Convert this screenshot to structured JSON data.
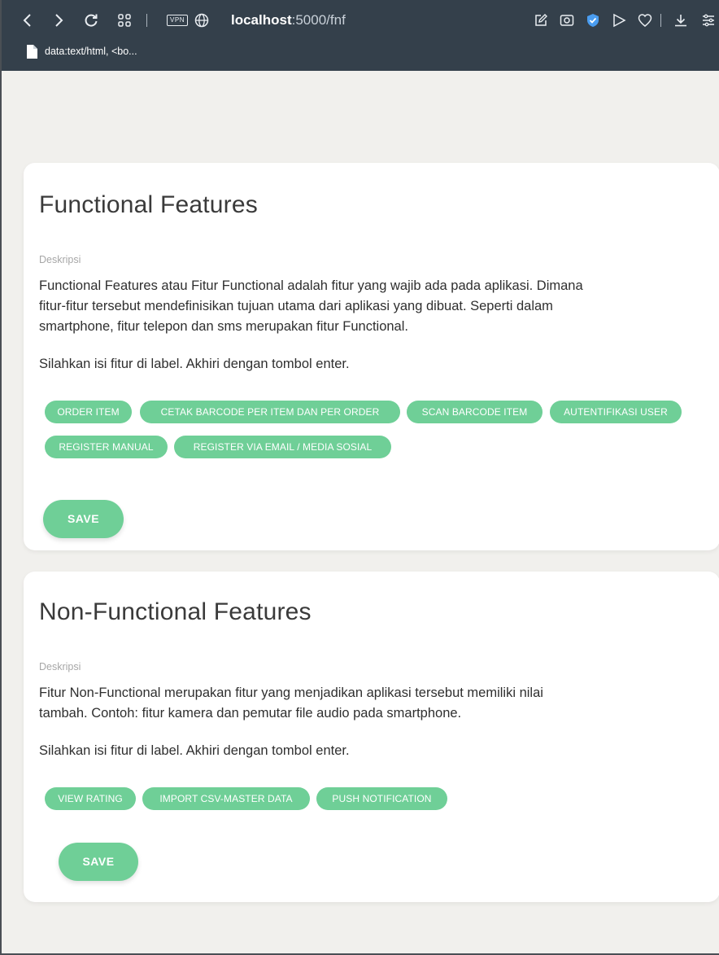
{
  "browser": {
    "vpn_label": "VPN",
    "url_host": "localhost",
    "url_path": ":5000/fnf",
    "tab_title": "data:text/html, <bo..."
  },
  "cards": [
    {
      "title": "Functional Features",
      "desc_label": "Deskripsi",
      "desc_lines": [
        "Functional Features atau Fitur Functional adalah fitur yang wajib ada pada aplikasi. Dimana",
        "fitur-fitur tersebut mendefinisikan tujuan utama dari aplikasi yang dibuat. Seperti dalam",
        "smartphone, fitur telepon dan sms merupakan fitur Functional."
      ],
      "hint": "Silahkan isi fitur di label. Akhiri dengan tombol enter.",
      "tags": [
        "ORDER ITEM",
        "CETAK BARCODE PER ITEM DAN PER ORDER",
        "SCAN BARCODE ITEM",
        "AUTENTIFIKASI USER",
        "REGISTER MANUAL",
        "REGISTER VIA EMAIL / MEDIA SOSIAL"
      ],
      "save_label": "SAVE"
    },
    {
      "title": "Non-Functional Features",
      "desc_label": "Deskripsi",
      "desc_lines": [
        "Fitur Non-Functional merupakan fitur yang menjadikan aplikasi tersebut memiliki nilai",
        "tambah. Contoh: fitur kamera dan pemutar file audio pada smartphone."
      ],
      "hint": "Silahkan isi fitur di label. Akhiri dengan tombol enter.",
      "tags": [
        "VIEW RATING",
        "IMPORT CSV-MASTER DATA",
        "PUSH NOTIFICATION"
      ],
      "save_label": "SAVE"
    }
  ],
  "colors": {
    "accent": "#6fcf97",
    "browser_bar": "#34404b",
    "page_bg": "#f1f0ed"
  },
  "icons": [
    "back-icon",
    "forward-icon",
    "reload-icon",
    "tabs-grid-icon",
    "vpn-icon",
    "globe-icon",
    "edit-icon",
    "screenshot-icon",
    "shield-check-icon",
    "send-icon",
    "heart-icon",
    "download-icon",
    "menu-icon",
    "document-icon"
  ]
}
